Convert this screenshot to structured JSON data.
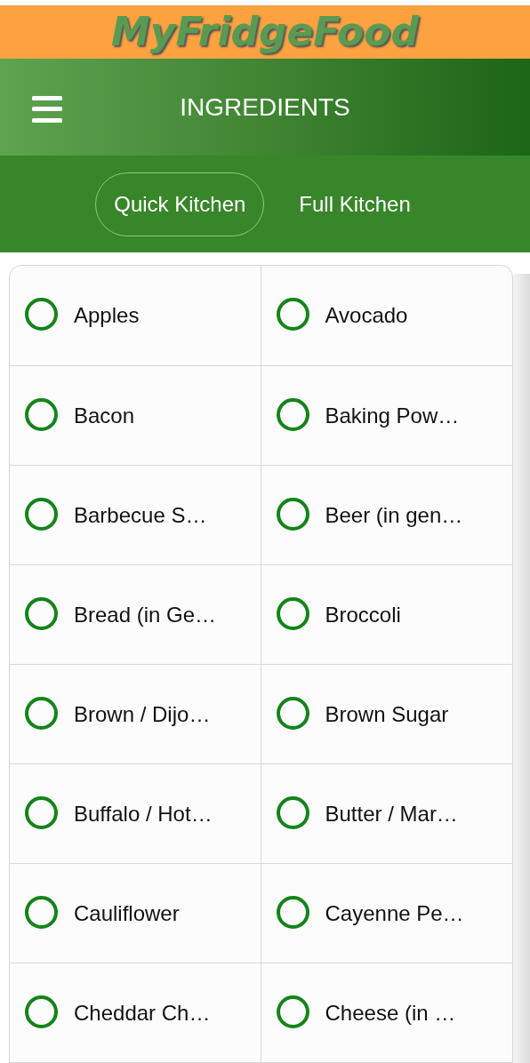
{
  "logo": "MyFridgeFood",
  "header": {
    "title": "INGREDIENTS"
  },
  "tabs": [
    {
      "label": "Quick Kitchen",
      "selected": true
    },
    {
      "label": "Full Kitchen",
      "selected": false
    }
  ],
  "ingredients": [
    {
      "label": "Apples",
      "checked": false
    },
    {
      "label": "Avocado",
      "checked": false
    },
    {
      "label": "Bacon",
      "checked": false
    },
    {
      "label": "Baking Pow…",
      "checked": false
    },
    {
      "label": "Barbecue S…",
      "checked": false
    },
    {
      "label": "Beer (in gen…",
      "checked": false
    },
    {
      "label": "Bread (in Ge…",
      "checked": false
    },
    {
      "label": "Broccoli",
      "checked": false
    },
    {
      "label": "Brown / Dijo…",
      "checked": false
    },
    {
      "label": "Brown Sugar",
      "checked": false
    },
    {
      "label": "Buffalo / Hot…",
      "checked": false
    },
    {
      "label": "Butter / Mar…",
      "checked": false
    },
    {
      "label": "Cauliflower",
      "checked": false
    },
    {
      "label": "Cayenne Pe…",
      "checked": false
    },
    {
      "label": "Cheddar Ch…",
      "checked": false
    },
    {
      "label": "Cheese (in …",
      "checked": false
    }
  ]
}
